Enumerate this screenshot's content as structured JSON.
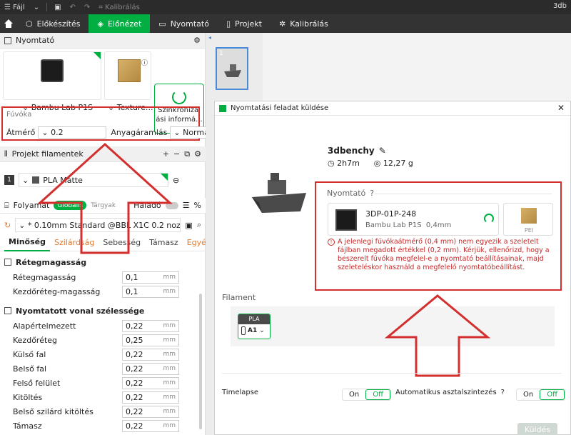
{
  "titlebar": {
    "menu": "Fájl",
    "calibration": "Kalibrálás",
    "project_name": "3db"
  },
  "tabs": [
    {
      "label": "Előkészítés"
    },
    {
      "label": "Előnézet"
    },
    {
      "label": "Nyomtató"
    },
    {
      "label": "Projekt"
    },
    {
      "label": "Kalibrálás"
    }
  ],
  "printer_section": {
    "title": "Nyomtató",
    "printer_name": "Bambu Lab P1S",
    "plate_name": "Texture...",
    "sync_label_1": "Szinkronizál",
    "sync_label_2": "ási informá..."
  },
  "nozzle": {
    "title": "Fúvóka",
    "diameter_label": "Átmérő",
    "diameter_value": "0.2",
    "flow_label": "Anyagáramlás",
    "flow_value": "Normál"
  },
  "filament_section": {
    "title": "Projekt filamentek",
    "slot": "1",
    "filament": "PLA Matte"
  },
  "process_section": {
    "title": "Folyamat",
    "global": "Globális",
    "objects": "Tárgyak",
    "advanced": "Haladó",
    "preset": "* 0.10mm Standard @BBL X1C 0.2 noz..."
  },
  "subtabs": [
    "Minőség",
    "Szilárdság",
    "Sebesség",
    "Támasz",
    "Egyéb"
  ],
  "layer_height_group": {
    "title": "Rétegmagasság",
    "rows": [
      {
        "name": "Rétegmagasság",
        "value": "0,1",
        "unit": "mm"
      },
      {
        "name": "Kezdőréteg-magasság",
        "value": "0,1",
        "unit": "mm"
      }
    ]
  },
  "line_width_group": {
    "title": "Nyomtatott vonal szélessége",
    "rows": [
      {
        "name": "Alapértelmezett",
        "value": "0,22",
        "unit": "mm"
      },
      {
        "name": "Kezdőréteg",
        "value": "0,25",
        "unit": "mm"
      },
      {
        "name": "Külső fal",
        "value": "0,22",
        "unit": "mm"
      },
      {
        "name": "Belső fal",
        "value": "0,22",
        "unit": "mm"
      },
      {
        "name": "Felső felület",
        "value": "0,22",
        "unit": "mm"
      },
      {
        "name": "Kitöltés",
        "value": "0,22",
        "unit": "mm"
      },
      {
        "name": "Belső szilárd kitöltés",
        "value": "0,22",
        "unit": "mm"
      },
      {
        "name": "Támasz",
        "value": "0,22",
        "unit": "mm"
      }
    ]
  },
  "thumbnail": {
    "index": "1"
  },
  "dialog": {
    "title": "Nyomtatási feladat küldése",
    "job_name": "3dbenchy",
    "time": "2h7m",
    "weight": "12,27 g",
    "printer_label": "Nyomtató",
    "printer_id": "3DP-01P-248",
    "printer_model": "Bambu Lab P1S",
    "nozzle_size": "0,4mm",
    "plate": "PEI",
    "warning_1": "A jelenlegi fúvókaátmérő (0,4 mm) nem egyezik a szeletelt",
    "warning_2": "fájlban megadott értékkel (0,2 mm). Kérjük, ellenőrizd, hogy a",
    "warning_3": "beszerelt fúvóka megfelel-e a nyomtató beállításainak, majd",
    "warning_4": "szeleteléskor használd a megfelelő nyomtatóbeállítást.",
    "filament_label": "Filament",
    "chip_material": "PLA",
    "chip_slot": "A1",
    "timelapse_label": "Timelapse",
    "autolevel_label": "Automatikus asztalszintezés",
    "on": "On",
    "off": "Off",
    "send": "Küldés"
  },
  "colors": {
    "accent": "#00ae42",
    "warning": "#d32f2f"
  }
}
